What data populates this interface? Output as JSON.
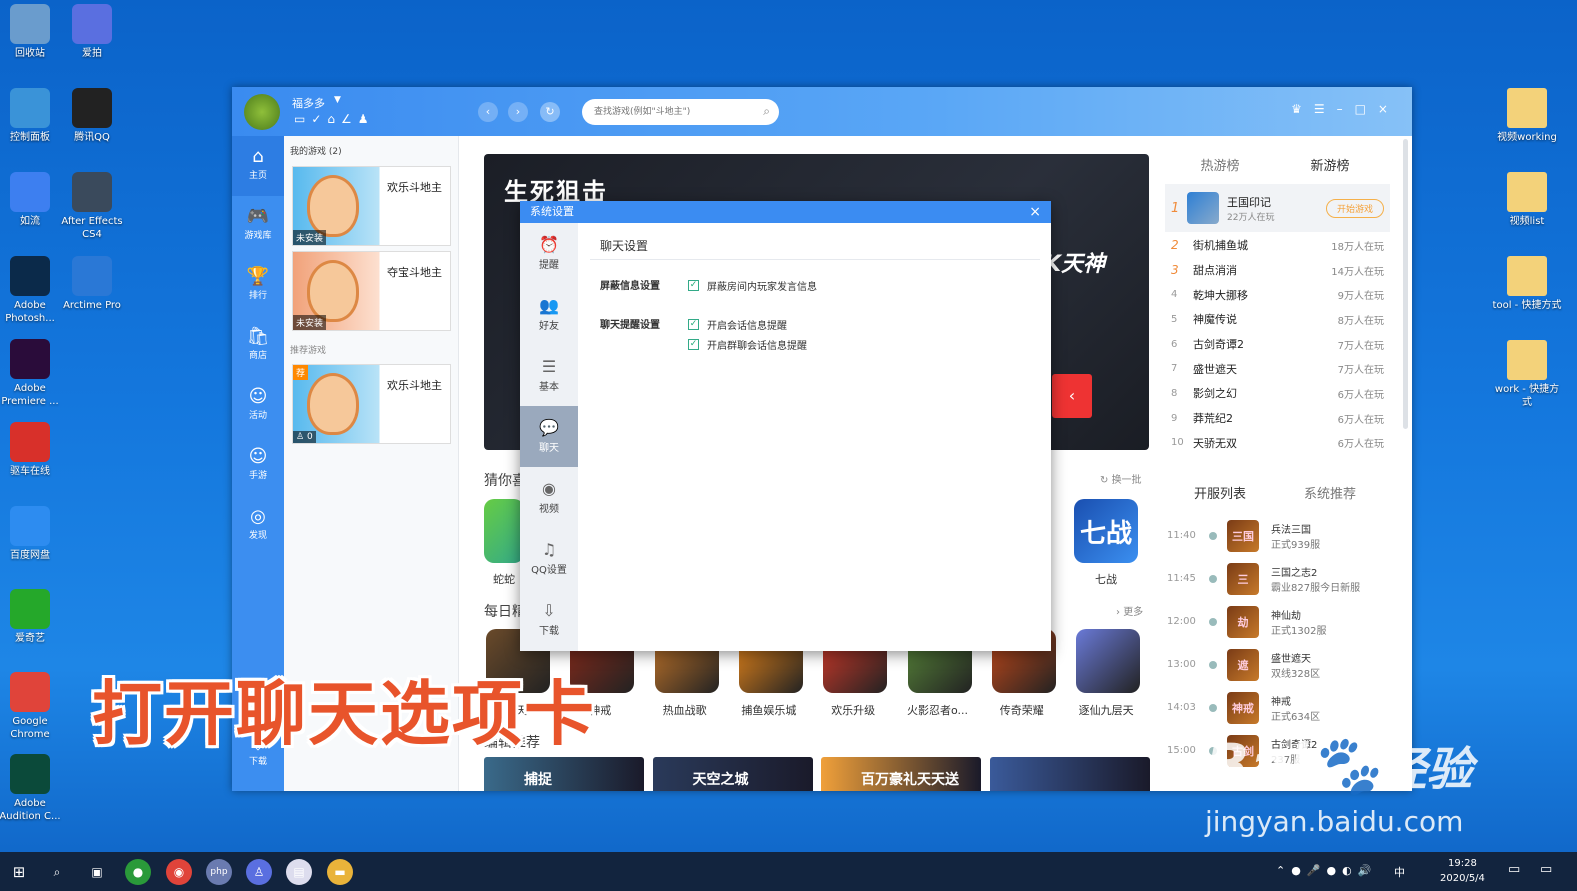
{
  "desktop_left": [
    {
      "label": "回收站",
      "icon": "recycle-bin-icon",
      "color": "#6a9ccd"
    },
    {
      "label": "爱拍",
      "icon": "aipai-icon",
      "color": "#5a6fe0"
    },
    {
      "label": "控制面板",
      "icon": "control-panel-icon",
      "color": "#3a93d8"
    },
    {
      "label": "腾讯QQ",
      "icon": "qq-icon",
      "color": "#222222"
    },
    {
      "label": "如流",
      "icon": "ruliu-icon",
      "color": "#3d7ff0"
    },
    {
      "label": "After Effects CS4",
      "icon": "after-effects-icon",
      "color": "#3a4a5c"
    },
    {
      "label": "Adobe Photosh...",
      "icon": "photoshop-icon",
      "color": "#0b2a4a"
    },
    {
      "label": "Arctime Pro",
      "icon": "arctime-icon",
      "color": "#2a78d6"
    },
    {
      "label": "Adobe Premiere ...",
      "icon": "premiere-icon",
      "color": "#2a0c3a"
    },
    {
      "label": "驱车在线",
      "icon": "pepsi-icon",
      "color": "#d8302a"
    },
    {
      "label": "百度网盘",
      "icon": "baidu-pan-icon",
      "color": "#2d8cf0"
    },
    {
      "label": "爱奇艺",
      "icon": "iqiyi-icon",
      "color": "#25a82a"
    },
    {
      "label": "Google Chrome",
      "icon": "chrome-icon",
      "color": "#e0443a"
    },
    {
      "label": "Adobe Audition C...",
      "icon": "audition-icon",
      "color": "#0b4a3a"
    }
  ],
  "desktop_right": [
    "视频working",
    "视频list",
    "tool - 快捷方式",
    "work - 快捷方式"
  ],
  "window": {
    "username": "福多多",
    "search_placeholder": "查找游戏(例如\"斗地主\")",
    "nav": [
      {
        "label": "主页",
        "glyph": "⌂"
      },
      {
        "label": "游戏库",
        "glyph": "🎮"
      },
      {
        "label": "排行",
        "glyph": "🏆"
      },
      {
        "label": "商店",
        "glyph": "🛍"
      },
      {
        "label": "活动",
        "glyph": "☺"
      },
      {
        "label": "手游",
        "glyph": "☺"
      },
      {
        "label": "发现",
        "glyph": "◎"
      }
    ],
    "nav_download": "下载",
    "my_games_header": "我的游戏 (2)",
    "my_games": [
      {
        "title": "欢乐斗地主",
        "status": "未安装"
      },
      {
        "title": "夺宝斗地主",
        "status": "未安装"
      }
    ],
    "recommend_header": "推荐游戏",
    "recommend_game": {
      "title": "欢乐斗地主",
      "badge": "荐",
      "count": "0"
    },
    "banner_text_1": "生死狙击",
    "banner_text_2": "K天神",
    "guess_label": "猜你喜",
    "refresh_label": "换一批",
    "daily_label": "每日精",
    "more_label": "更多",
    "editor_label": "编辑推荐",
    "guess_games": [
      {
        "label": "蛇蛇"
      },
      {
        "label": "七战"
      }
    ],
    "daily_games": [
      "天天",
      "神戒",
      "热血战歌",
      "捕鱼娱乐城",
      "欢乐升级",
      "火影忍者o...",
      "传奇荣耀",
      "逐仙九层天"
    ],
    "editor_banners": [
      "捕捉",
      "天空之城",
      "百万豪礼天天送",
      ""
    ],
    "rank_tabs": [
      "热游榜",
      "新游榜"
    ],
    "top_game": {
      "rank": "1",
      "name": "王国印记",
      "players": "22万人在玩",
      "button": "开始游戏"
    },
    "ranks": [
      {
        "n": "2",
        "name": "街机捕鱼城",
        "players": "18万人在玩"
      },
      {
        "n": "3",
        "name": "甜点消消",
        "players": "14万人在玩"
      },
      {
        "n": "4",
        "name": "乾坤大挪移",
        "players": "9万人在玩"
      },
      {
        "n": "5",
        "name": "神魔传说",
        "players": "8万人在玩"
      },
      {
        "n": "6",
        "name": "古剑奇谭2",
        "players": "7万人在玩"
      },
      {
        "n": "7",
        "name": "盛世遮天",
        "players": "7万人在玩"
      },
      {
        "n": "8",
        "name": "影剑之幻",
        "players": "6万人在玩"
      },
      {
        "n": "9",
        "name": "莽荒纪2",
        "players": "6万人在玩"
      },
      {
        "n": "10",
        "name": "天骄无双",
        "players": "6万人在玩"
      }
    ],
    "server_tabs": [
      "开服列表",
      "系统推荐"
    ],
    "servers": [
      {
        "time": "11:40",
        "name": "兵法三国",
        "info": "正式939服",
        "icon": "三国"
      },
      {
        "time": "11:45",
        "name": "三国之志2",
        "info": "霸业827服今日新服",
        "icon": "三"
      },
      {
        "time": "12:00",
        "name": "神仙劫",
        "info": "正式1302服",
        "icon": "劫"
      },
      {
        "time": "13:00",
        "name": "盛世遮天",
        "info": "双线328区",
        "icon": "遮"
      },
      {
        "time": "14:03",
        "name": "神戒",
        "info": "正式634区",
        "icon": "神戒"
      },
      {
        "time": "15:00",
        "name": "古剑奇谭2",
        "info": "237服",
        "icon": "古剑"
      }
    ]
  },
  "dialog": {
    "title": "系统设置",
    "close": "×",
    "nav": [
      {
        "label": "提醒",
        "glyph": "⏰"
      },
      {
        "label": "好友",
        "glyph": "👥"
      },
      {
        "label": "基本",
        "glyph": "☰"
      },
      {
        "label": "聊天",
        "glyph": "💬"
      },
      {
        "label": "视频",
        "glyph": "◉"
      },
      {
        "label": "QQ设置",
        "glyph": "♫"
      },
      {
        "label": "下载",
        "glyph": "⇩"
      }
    ],
    "heading": "聊天设置",
    "block_label": "屏蔽信息设置",
    "block_option": "屏蔽房间内玩家发言信息",
    "notify_label": "聊天提醒设置",
    "notify_option_1": "开启会话信息提醒",
    "notify_option_2": "开启群聊会话信息提醒"
  },
  "caption": "打开聊天选项卡",
  "watermark": {
    "brand": "Bai",
    "brand2": "经验",
    "url": "jingyan.baidu.com"
  },
  "taskbar": {
    "time": "19:28",
    "date": "2020/5/4",
    "ime": "中"
  },
  "colors": {
    "accent": "#3b8cf2",
    "caption": "#e8542b"
  }
}
